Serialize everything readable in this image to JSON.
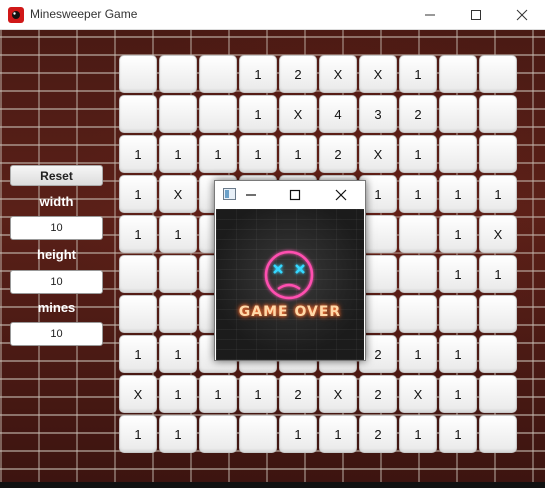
{
  "window": {
    "title": "Minesweeper Game",
    "minimize_symbol": "—",
    "maximize_symbol": "☐",
    "close_symbol": "✕",
    "icon": "red-mine-app-icon"
  },
  "controls": {
    "reset_label": "Reset",
    "width_label": "width",
    "width_value": "10",
    "height_label": "height",
    "height_value": "10",
    "mines_label": "mines",
    "mines_value": "10"
  },
  "board": {
    "rows": [
      [
        "",
        "",
        "",
        "1",
        "2",
        "X",
        "X",
        "1",
        "",
        ""
      ],
      [
        "",
        "",
        "",
        "1",
        "X",
        "4",
        "3",
        "2",
        "",
        ""
      ],
      [
        "1",
        "1",
        "1",
        "1",
        "1",
        "2",
        "X",
        "1",
        "",
        ""
      ],
      [
        "1",
        "X",
        "",
        "",
        "",
        "",
        "1",
        "1",
        "1",
        "1"
      ],
      [
        "1",
        "1",
        "",
        "",
        "",
        "",
        "",
        "",
        "1",
        "X"
      ],
      [
        "",
        "",
        "",
        "",
        "",
        "",
        "",
        "",
        "1",
        "1"
      ],
      [
        "",
        "",
        "",
        "",
        "",
        "",
        "",
        "",
        "",
        ""
      ],
      [
        "1",
        "1",
        "",
        "",
        "",
        "",
        "2",
        "1",
        "1",
        ""
      ],
      [
        "X",
        "1",
        "1",
        "1",
        "2",
        "X",
        "2",
        "X",
        "1",
        ""
      ],
      [
        "1",
        "1",
        "",
        "",
        "1",
        "1",
        "2",
        "1",
        "1",
        ""
      ]
    ]
  },
  "popup": {
    "text": "GAME OVER",
    "icon": "image-app-icon",
    "colors": {
      "neon_pink": "#ff4fb0",
      "neon_cyan": "#35d7ff",
      "neon_orange": "#ff7a3a"
    }
  },
  "colors": {
    "cell": "#f2f2f2",
    "brick": "#5a2018",
    "mortar": "#c8beb4"
  }
}
